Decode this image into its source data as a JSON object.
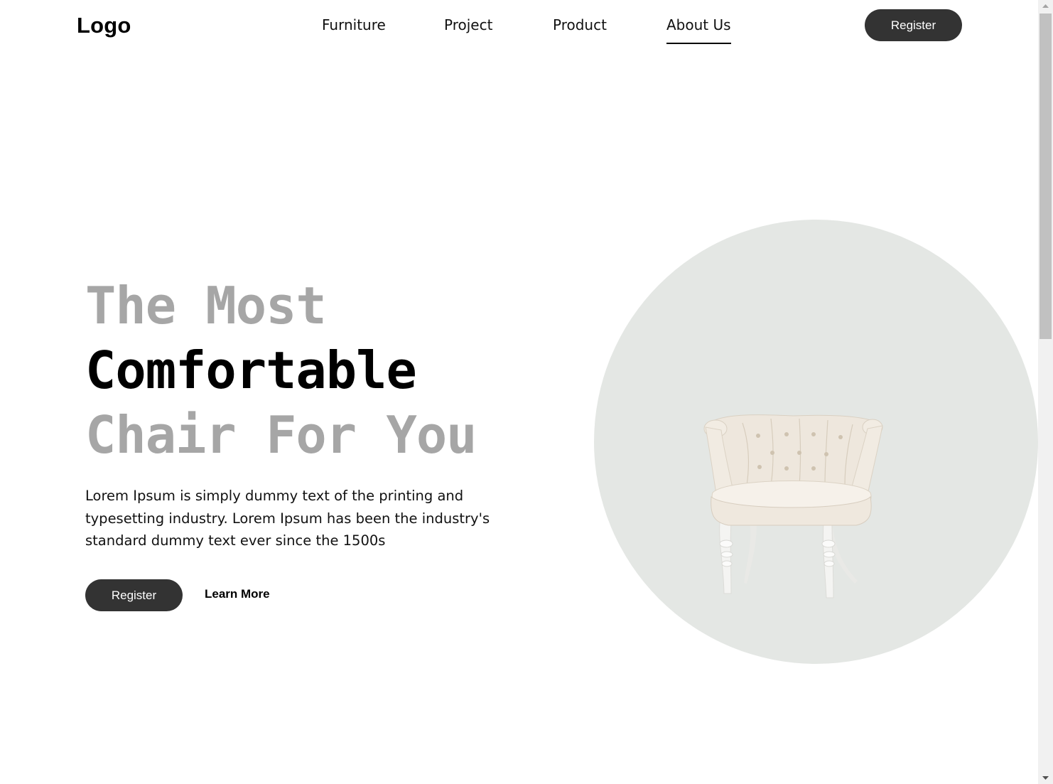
{
  "header": {
    "logo": "Logo",
    "nav": [
      {
        "label": "Furniture",
        "active": false
      },
      {
        "label": "Project",
        "active": false
      },
      {
        "label": "Product",
        "active": false
      },
      {
        "label": "About Us",
        "active": true
      }
    ],
    "register_label": "Register"
  },
  "hero": {
    "title_lines": [
      "The Most",
      "Comfortable",
      "Chair For You"
    ],
    "description": "Lorem Ipsum is simply dummy text of the printing and typesetting industry. Lorem Ipsum has been the industry's standard dummy text ever since the 1500s",
    "register_label": "Register",
    "learn_more_label": "Learn More",
    "image": {
      "icon": "armchair-image",
      "alt": "cream tufted armchair"
    }
  },
  "colors": {
    "button_bg": "#333333",
    "button_text": "#ffffff",
    "title_muted": "#a6a6a6",
    "title_strong": "#000000",
    "circle_bg": "#e4e7e4"
  },
  "scrollbar": {
    "up_icon": "scroll-up-arrow-icon",
    "down_icon": "scroll-down-arrow-icon"
  }
}
